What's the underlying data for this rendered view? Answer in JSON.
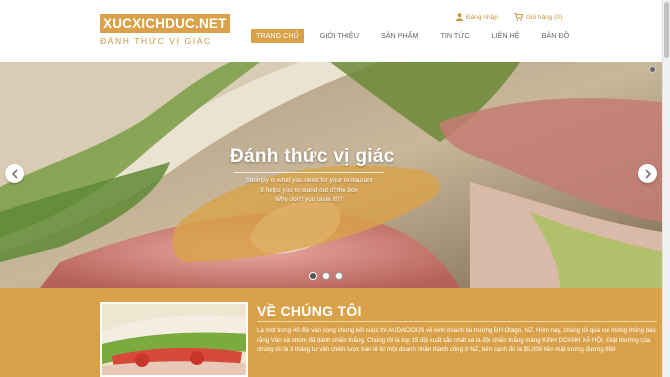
{
  "logo": {
    "brand": "XUCXICHDUC.NET",
    "tagline": "ĐÁNH THỨC VỊ GIÁC"
  },
  "account": {
    "login_label": "Đăng nhập",
    "cart_label": "Giỏ hàng (0)"
  },
  "nav": {
    "items": [
      {
        "label": "TRANG CHỦ",
        "active": true
      },
      {
        "label": "GIỚI THIỆU"
      },
      {
        "label": "SẢN PHẨM"
      },
      {
        "label": "TIN TỨC"
      },
      {
        "label": "LIÊN HỆ"
      },
      {
        "label": "BẢN ĐỒ"
      }
    ]
  },
  "slider": {
    "title": "Đánh thức vị giác",
    "lines": [
      "Shrimpy is what you need for your restaurant",
      "It helps you to stand out of the box",
      "Why don't you taste it!!?"
    ],
    "slide_count": 3,
    "active_slide": 1
  },
  "about": {
    "title": "VỀ CHÚNG TÔI",
    "text": "Là một trong 40 đội vào vòng chung kết cuộc thi AUDACIOUS về kinh doanh tại trường ĐH Otago, NZ. Hôm nay, chúng tôi quá vui mừng thông báo rằng Vân và nhóm đã dành chiến thắng. Chúng tôi là top 15 đội xuất sắc nhất và là đội chiến thắng mảng KINH DOANH XÃ HỘI. Giải thưởng của chúng tôi là 3 tháng tư vấn chiến lược bán lẻ từ một doanh nhân thành công ở NZ, bên cạnh đó là $5,000 tiền mặt tương đương 85tr"
  },
  "colors": {
    "accent": "#d9a24a",
    "text": "#555555"
  },
  "icons": {
    "login": "user-icon",
    "cart": "cart-icon",
    "prev": "chevron-left-icon",
    "next": "chevron-right-icon"
  }
}
